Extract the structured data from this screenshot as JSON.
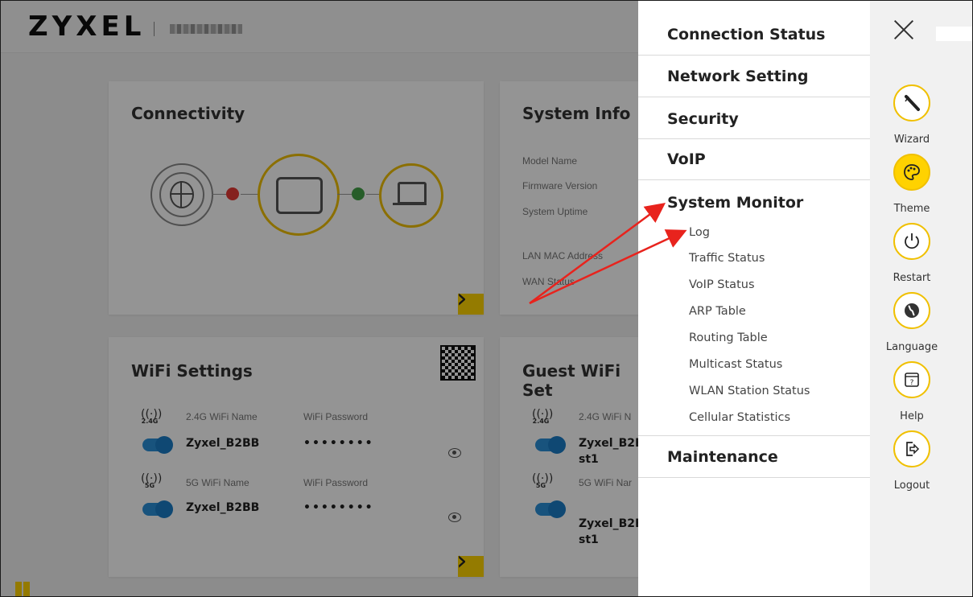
{
  "header": {
    "logo": "ZYXEL"
  },
  "dashboard": {
    "connectivity": {
      "title": "Connectivity"
    },
    "system_info": {
      "title": "System Info",
      "labels": [
        "Model Name",
        "Firmware Version",
        "System Uptime",
        "LAN MAC Address",
        "WAN Status"
      ]
    },
    "wifi": {
      "title": "WiFi Settings",
      "rows": [
        {
          "band": "2.4G",
          "name_label": "2.4G WiFi Name",
          "pass_label": "WiFi Password",
          "name": "Zyxel_B2BB",
          "password": "••••••••"
        },
        {
          "band": "5G",
          "name_label": "5G WiFi Name",
          "pass_label": "WiFi Password",
          "name": "Zyxel_B2BB",
          "password": "••••••••"
        }
      ]
    },
    "guest_wifi": {
      "title": "Guest WiFi Set",
      "rows": [
        {
          "band": "2.4G",
          "name_label": "2.4G WiFi N",
          "name_line1": "Zyxel_B2B",
          "name_line2": "st1"
        },
        {
          "band": "5G",
          "name_label": "5G WiFi Nar",
          "name_line1": "Zyxel_B2B",
          "name_line2": "st1"
        }
      ]
    }
  },
  "menu": {
    "items": [
      "Connection Status",
      "Network Setting",
      "Security",
      "VoIP",
      "System Monitor",
      "Maintenance"
    ],
    "system_monitor_sub": [
      "Log",
      "Traffic Status",
      "VoIP Status",
      "ARP Table",
      "Routing Table",
      "Multicast Status",
      "WLAN Station Status",
      "Cellular Statistics"
    ]
  },
  "rail": {
    "buttons": [
      {
        "label": "Wizard",
        "icon": "wand-icon"
      },
      {
        "label": "Theme",
        "icon": "palette-icon"
      },
      {
        "label": "Restart",
        "icon": "power-icon"
      },
      {
        "label": "Language",
        "icon": "globe-icon"
      },
      {
        "label": "Help",
        "icon": "help-window-icon"
      },
      {
        "label": "Logout",
        "icon": "logout-icon"
      }
    ]
  },
  "colors": {
    "accent_yellow": "#ffd200",
    "annotation_arrow": "#e8231d",
    "toggle_blue": "#1a7cc6"
  }
}
